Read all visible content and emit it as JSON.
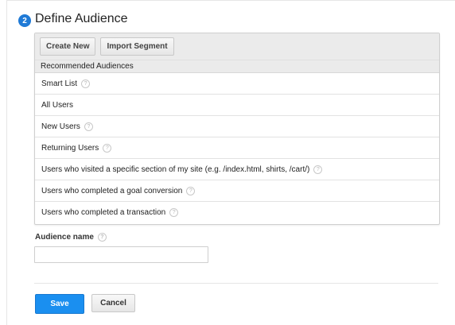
{
  "step": {
    "number": "2",
    "title": "Define Audience"
  },
  "toolbar": {
    "create_new": "Create New",
    "import_segment": "Import Segment"
  },
  "list": {
    "header": "Recommended Audiences",
    "items": [
      {
        "label": "Smart List",
        "help": true
      },
      {
        "label": "All Users",
        "help": false
      },
      {
        "label": "New Users",
        "help": true
      },
      {
        "label": "Returning Users",
        "help": true
      },
      {
        "label": "Users who visited a specific section of my site (e.g. /index.html, shirts, /cart/)",
        "help": true
      },
      {
        "label": "Users who completed a goal conversion",
        "help": true
      },
      {
        "label": "Users who completed a transaction",
        "help": true
      }
    ]
  },
  "audience_name": {
    "label": "Audience name",
    "value": "",
    "placeholder": ""
  },
  "actions": {
    "save": "Save",
    "cancel": "Cancel"
  },
  "help_glyph": "?",
  "colors": {
    "accent": "#1a8ff0",
    "step_circle": "#1f7ad6",
    "panel_header": "#ebebeb"
  }
}
